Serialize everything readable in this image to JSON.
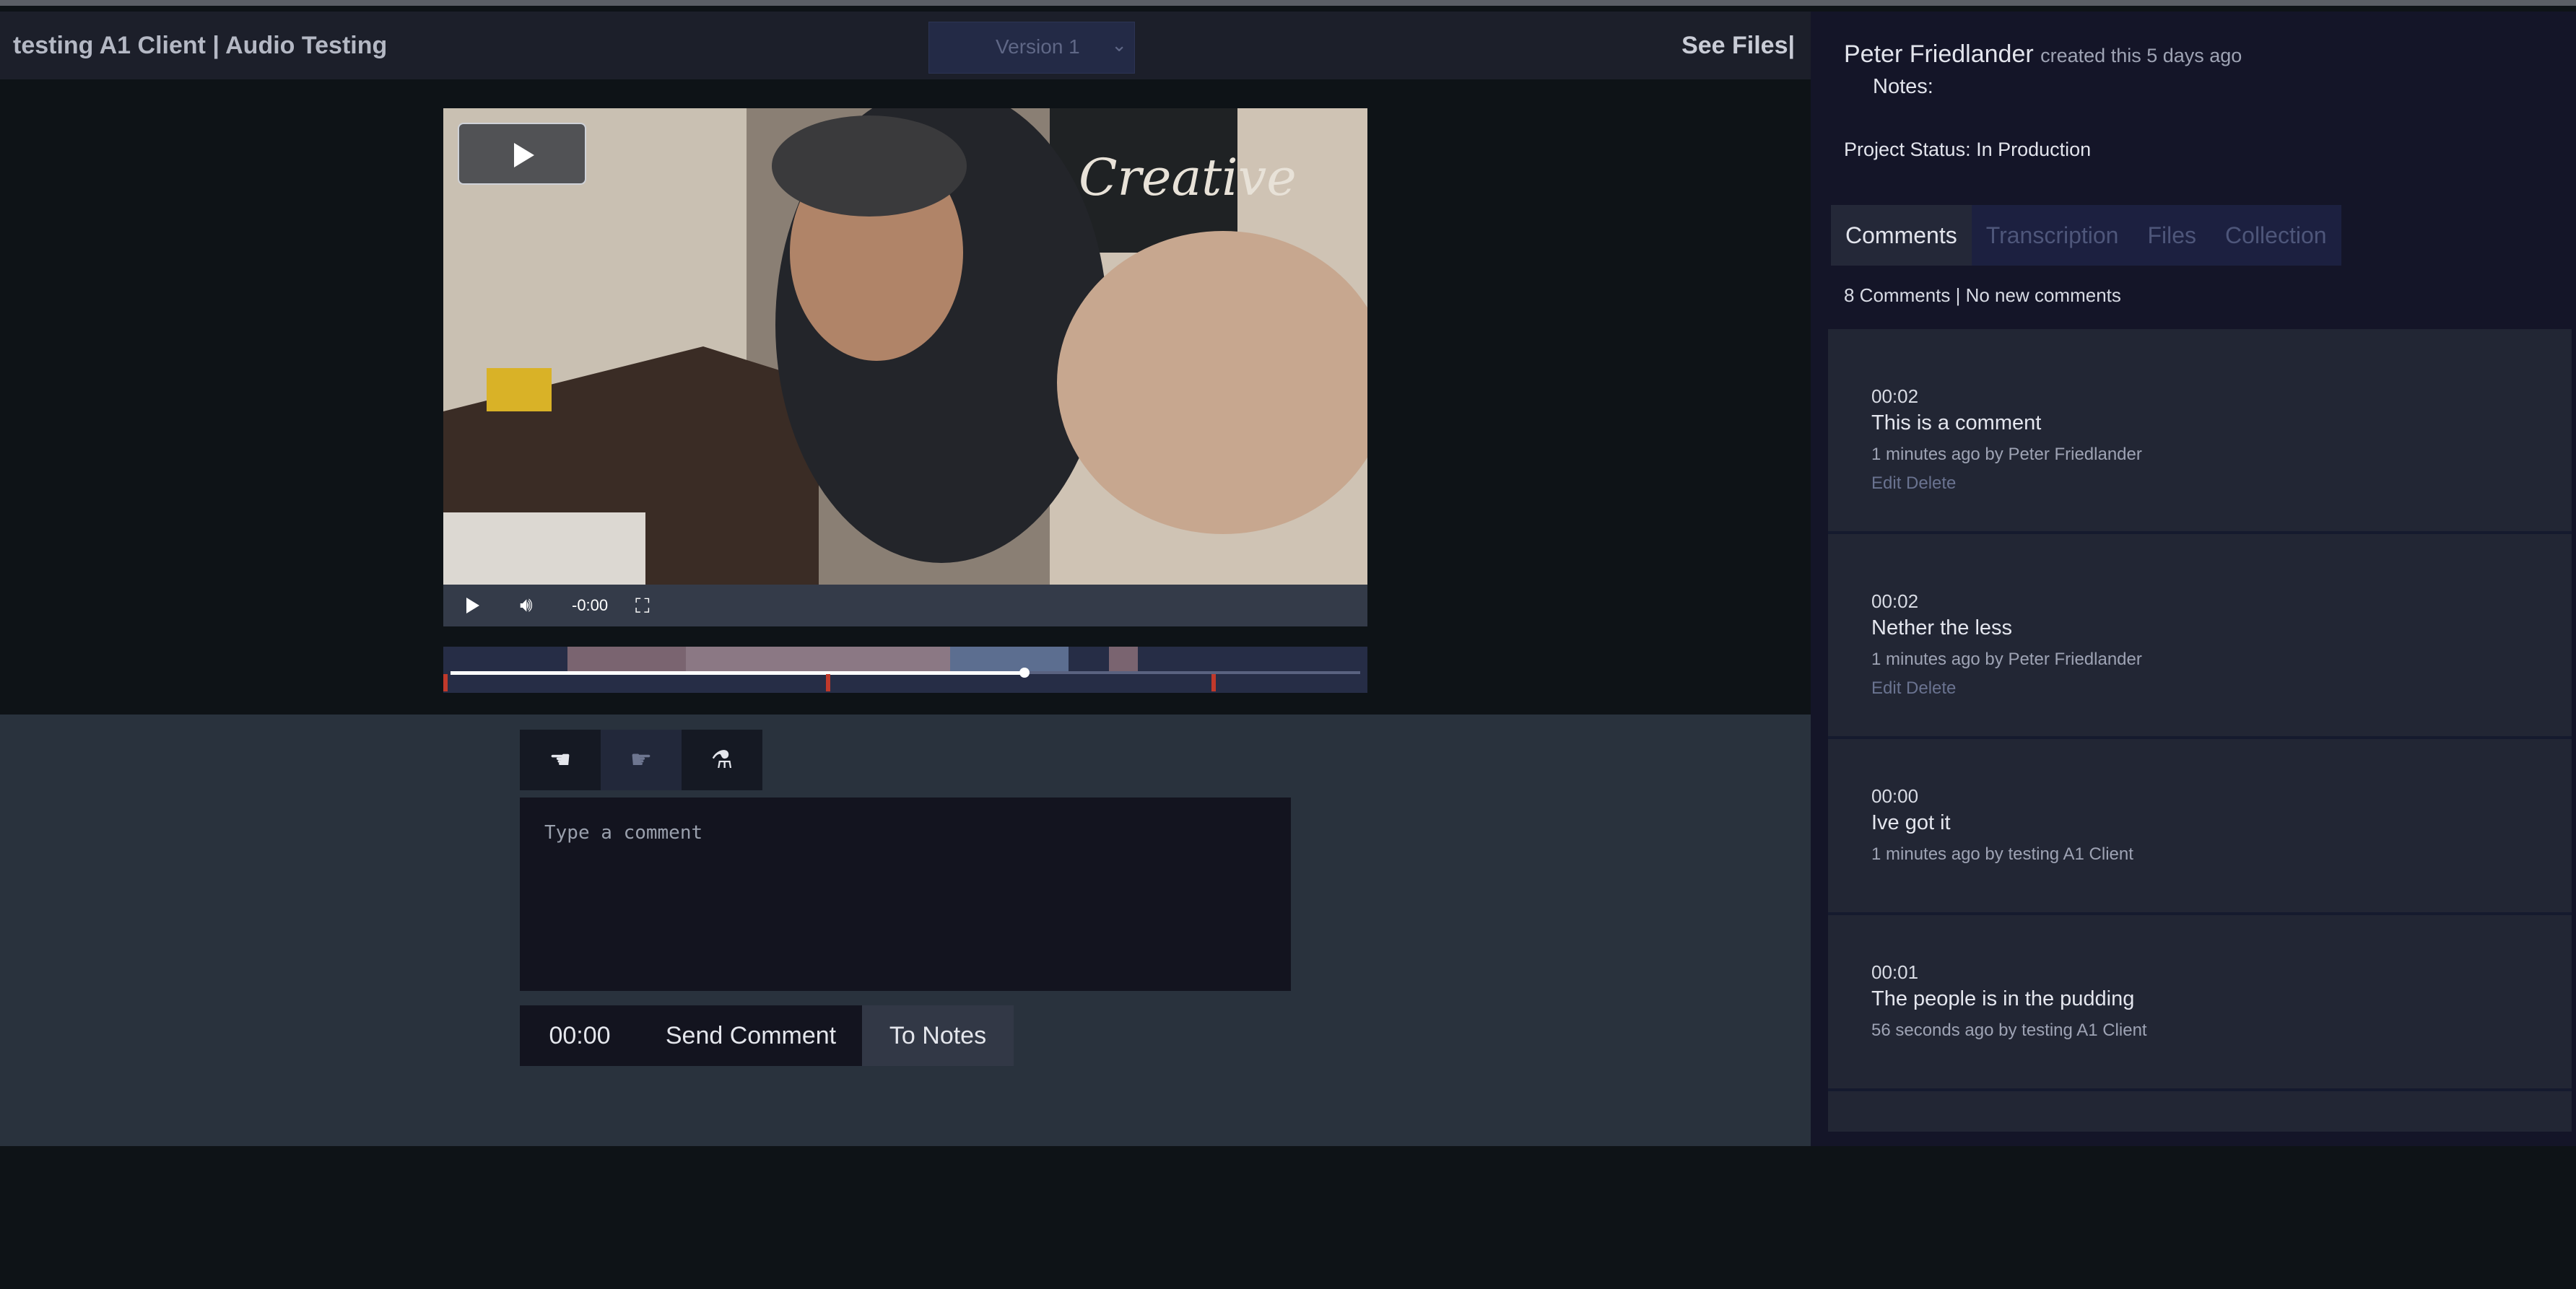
{
  "header": {
    "title": "testing A1 Client | Audio Testing",
    "version_selected": "Version 1",
    "see_files": "See Files|"
  },
  "player": {
    "time_display": "-0:00",
    "progress": 0.63
  },
  "entry": {
    "placeholder": "Type a comment",
    "timecode": "00:00",
    "send_label": "Send Comment",
    "notes_label": "To Notes"
  },
  "sidebar": {
    "creator_name": "Peter Friedlander",
    "created_text": "created this 5 days ago",
    "notes_label": "Notes:",
    "status": "Project Status: In Production",
    "tabs": [
      "Comments",
      "Transcription",
      "Files",
      "Collection"
    ],
    "active_tab": "Comments",
    "counts": "8 Comments | No new comments"
  },
  "comments": [
    {
      "time": "00:02",
      "text": "This is a comment",
      "meta": "1 minutes ago by Peter Friedlander",
      "edit": "Edit",
      "delete": "Delete"
    },
    {
      "time": "00:02",
      "text": "Nether the less",
      "meta": "1 minutes ago by Peter Friedlander",
      "edit": "Edit",
      "delete": "Delete"
    },
    {
      "time": "00:00",
      "text": "Ive got it",
      "meta": "1 minutes ago by testing A1 Client"
    },
    {
      "time": "00:01",
      "text": "The people is in the pudding",
      "meta": "56 seconds ago by testing A1 Client"
    }
  ],
  "icons": {
    "tool_1": "hand-pointer-icon",
    "tool_2": "hand-point-icon",
    "tool_3": "mortar-pestle-icon",
    "volume": "volume-icon",
    "fullscreen": "fullscreen-icon",
    "play": "play-icon"
  },
  "colors": {
    "sidebar_bg": "#141528",
    "comment_bg": "#222634",
    "timeline_marker": "#c0392b",
    "entry_bg": "#29323d"
  }
}
